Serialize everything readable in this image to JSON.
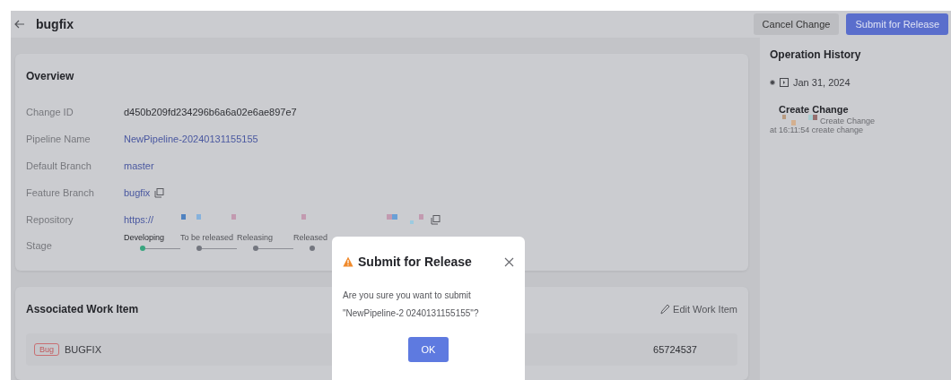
{
  "header": {
    "title": "bugfix",
    "buttons": [
      {
        "label": "Cancel Change",
        "kind": "secondary"
      },
      {
        "label": "Submit for Release",
        "kind": "primary"
      }
    ]
  },
  "overview": {
    "title": "Overview",
    "fields": [
      {
        "label": "Change ID",
        "value": "d450b209fd234296b6a6a02e6ae897e7",
        "kind": "text"
      },
      {
        "label": "Pipeline Name",
        "value": "NewPipeline-20240131155155",
        "kind": "link"
      },
      {
        "label": "Default Branch",
        "value": "master",
        "kind": "link"
      },
      {
        "label": "Feature Branch",
        "value": "bugfix",
        "kind": "copy"
      },
      {
        "label": "Repository",
        "value": "https://",
        "kind": "redacted"
      }
    ],
    "stage": {
      "label": "Stage",
      "steps": [
        {
          "name": "Developing",
          "selected": true
        },
        {
          "name": "To be released",
          "selected": false
        },
        {
          "name": "Releasing",
          "selected": false
        },
        {
          "name": "Released",
          "selected": false
        }
      ]
    }
  },
  "work_items": {
    "title": "Associated Work Item",
    "edit": "Edit Work Item",
    "rows": [
      {
        "tag": "Bug",
        "name": "BUGFIX",
        "id": "65724537"
      }
    ]
  },
  "history": {
    "title": "Operation History",
    "date": "Jan 31, 2024",
    "entries": [
      {
        "title": "Create Change",
        "action": "Create Change",
        "detail": "at 16:11:54 create change"
      }
    ]
  },
  "dialog": {
    "title": "Submit for Release",
    "message": "Are you sure you want to submit \"NewPipeline-2 0240131155155\"?",
    "ok": "OK"
  }
}
